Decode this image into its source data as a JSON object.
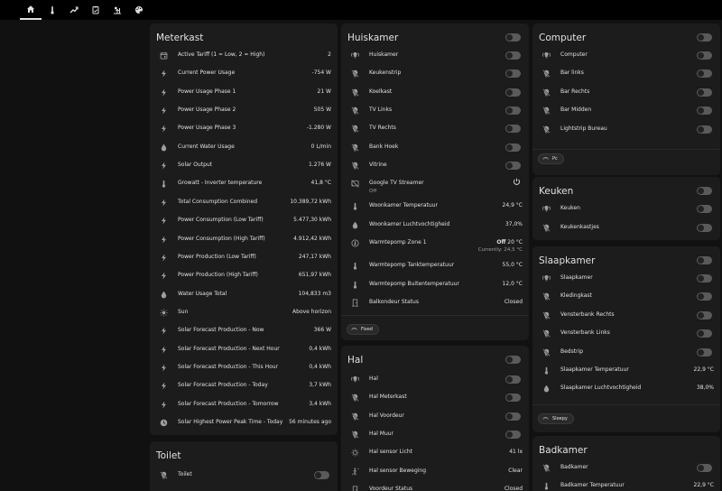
{
  "nav": {
    "tabs": [
      {
        "icon": "home-icon",
        "active": true
      },
      {
        "icon": "thermometer-icon",
        "active": false
      },
      {
        "icon": "chart-icon",
        "active": false
      },
      {
        "icon": "clipboard-icon",
        "active": false
      },
      {
        "icon": "weather-icon",
        "active": false
      },
      {
        "icon": "palette-icon",
        "active": false
      }
    ]
  },
  "meterkast": {
    "title": "Meterkast",
    "rows": [
      {
        "icon": "calendar-icon",
        "name": "Active Tariff (1 = Low, 2 = High)",
        "value": "2"
      },
      {
        "icon": "flash-icon",
        "name": "Current Power Usage",
        "value": "-754 W"
      },
      {
        "icon": "flash-icon",
        "name": "Power Usage Phase 1",
        "value": "21 W"
      },
      {
        "icon": "flash-icon",
        "name": "Power Usage Phase 2",
        "value": "505 W"
      },
      {
        "icon": "flash-icon",
        "name": "Power Usage Phase 3",
        "value": "-1.280 W"
      },
      {
        "icon": "water-icon",
        "name": "Current Water Usage",
        "value": "0 L/min"
      },
      {
        "icon": "flash-icon",
        "name": "Solar Output",
        "value": "1.276 W"
      },
      {
        "icon": "thermometer-icon",
        "name": "Growatt - Inverter temperature",
        "value": "41,8 °C"
      },
      {
        "icon": "flash-icon",
        "name": "Total Consumption Combined",
        "value": "10.389,72 kWh"
      },
      {
        "icon": "flash-icon",
        "name": "Power Consumption (Low Tariff)",
        "value": "5.477,30 kWh"
      },
      {
        "icon": "flash-icon",
        "name": "Power Consumption (High Tariff)",
        "value": "4.912,42 kWh"
      },
      {
        "icon": "flash-icon",
        "name": "Power Production (Low Tariff)",
        "value": "247,17 kWh"
      },
      {
        "icon": "flash-icon",
        "name": "Power Production (High Tariff)",
        "value": "651,97 kWh"
      },
      {
        "icon": "water-icon",
        "name": "Water Usage Total",
        "value": "104,833 m3"
      },
      {
        "icon": "sun-icon",
        "name": "Sun",
        "value": "Above horizon"
      },
      {
        "icon": "flash-icon",
        "name": "Solar Forecast Production - Now",
        "value": "366 W"
      },
      {
        "icon": "flash-icon",
        "name": "Solar Forecast Production - Next Hour",
        "value": "0,4 kWh"
      },
      {
        "icon": "flash-icon",
        "name": "Solar Forecast Production - This Hour",
        "value": "0,4 kWh"
      },
      {
        "icon": "flash-icon",
        "name": "Solar Forecast Production - Today",
        "value": "3,7 kWh"
      },
      {
        "icon": "flash-icon",
        "name": "Solar Forecast Production - Tomorrow",
        "value": "3,4 kWh"
      },
      {
        "icon": "clock-icon",
        "name": "Solar Highest Power Peak Time - Today",
        "value": "56 minutes ago"
      }
    ]
  },
  "toilet": {
    "title": "Toilet",
    "rows": [
      {
        "icon": "lightbulb-off-icon",
        "name": "Toilet"
      }
    ]
  },
  "huiskamer": {
    "title": "Huiskamer",
    "rows": [
      {
        "icon": "lightbulb-group-icon",
        "name": "Huiskamer",
        "type": "toggle"
      },
      {
        "icon": "lightbulb-off-icon",
        "name": "Keukenstrip",
        "type": "toggle"
      },
      {
        "icon": "lightbulb-off-icon",
        "name": "Koelkast",
        "type": "toggle"
      },
      {
        "icon": "lightbulb-off-icon",
        "name": "TV Links",
        "type": "toggle"
      },
      {
        "icon": "lightbulb-off-icon",
        "name": "TV Rechts",
        "type": "toggle"
      },
      {
        "icon": "lightbulb-off-icon",
        "name": "Bank Hoek",
        "type": "toggle"
      },
      {
        "icon": "lightbulb-off-icon",
        "name": "Vitrine",
        "type": "toggle"
      },
      {
        "icon": "cast-off-icon",
        "name": "Google TV Streamer",
        "sub": "Off",
        "type": "power"
      },
      {
        "icon": "thermometer-icon",
        "name": "Woonkamer Temperatuur",
        "value": "24,9 °C",
        "type": "value"
      },
      {
        "icon": "water-icon",
        "name": "Woonkamer Luchtvochtigheid",
        "value": "37,0%",
        "type": "value"
      },
      {
        "icon": "thermostat-icon",
        "name": "Warmtepomp Zone 1",
        "value_bold": "Off",
        "value": "20 °C",
        "value2": "Currently: 24,5 °C",
        "type": "climate"
      },
      {
        "icon": "thermometer-icon",
        "name": "Warmtepomp Tanktemperatuur",
        "value": "55,0 °C",
        "type": "value"
      },
      {
        "icon": "thermometer-icon",
        "name": "Warmtepomp Buitentemperatuur",
        "value": "12,0 °C",
        "type": "value"
      },
      {
        "icon": "door-icon",
        "name": "Balkondeur Status",
        "value": "Closed",
        "type": "value"
      }
    ],
    "chip": "Fixed"
  },
  "hal": {
    "title": "Hal",
    "rows": [
      {
        "icon": "lightbulb-group-icon",
        "name": "Hal",
        "type": "toggle"
      },
      {
        "icon": "lightbulb-off-icon",
        "name": "Hal Meterkast",
        "type": "toggle"
      },
      {
        "icon": "lightbulb-off-icon",
        "name": "Hal Voordeur",
        "type": "toggle"
      },
      {
        "icon": "lightbulb-off-icon",
        "name": "Hal Muur",
        "type": "toggle"
      },
      {
        "icon": "brightness-icon",
        "name": "Hal sensor Licht",
        "value": "41 lx",
        "type": "value"
      },
      {
        "icon": "motion-sensor-icon",
        "name": "Hal sensor Beweging",
        "value": "Clear",
        "type": "value"
      },
      {
        "icon": "door-icon",
        "name": "Voordeur Status",
        "value": "Closed",
        "type": "value"
      }
    ]
  },
  "computer": {
    "title": "Computer",
    "rows": [
      {
        "icon": "lightbulb-group-icon",
        "name": "Computer"
      },
      {
        "icon": "lightbulb-off-icon",
        "name": "Bar links"
      },
      {
        "icon": "lightbulb-off-icon",
        "name": "Bar Rechts"
      },
      {
        "icon": "lightbulb-off-icon",
        "name": "Bar Midden"
      },
      {
        "icon": "lightbulb-off-icon",
        "name": "Lightstrip Bureau"
      }
    ],
    "chip": "Pc"
  },
  "keuken": {
    "title": "Keuken",
    "rows": [
      {
        "icon": "lightbulb-group-icon",
        "name": "Keuken"
      },
      {
        "icon": "lightbulb-off-icon",
        "name": "Keukenkastjes"
      }
    ]
  },
  "slaapkamer": {
    "title": "Slaapkamer",
    "rows": [
      {
        "icon": "lightbulb-group-icon",
        "name": "Slaapkamer",
        "type": "toggle"
      },
      {
        "icon": "lightbulb-off-icon",
        "name": "Kledingkast",
        "type": "toggle"
      },
      {
        "icon": "lightbulb-off-icon",
        "name": "Vensterbank Rechts",
        "type": "toggle"
      },
      {
        "icon": "lightbulb-off-icon",
        "name": "Vensterbank Links",
        "type": "toggle"
      },
      {
        "icon": "lightbulb-off-icon",
        "name": "Bedstrip",
        "type": "toggle"
      },
      {
        "icon": "thermometer-icon",
        "name": "Slaapkamer Temperatuur",
        "value": "22,9 °C",
        "type": "value"
      },
      {
        "icon": "water-icon",
        "name": "Slaapkamer Luchtvochtigheid",
        "value": "38,0%",
        "type": "value"
      }
    ],
    "chip": "Sleepy"
  },
  "badkamer": {
    "title": "Badkamer",
    "rows": [
      {
        "icon": "lightbulb-off-icon",
        "name": "Badkamer",
        "type": "toggle"
      },
      {
        "icon": "thermometer-icon",
        "name": "Badkamer Temperatuur",
        "value": "22,9 °C",
        "type": "value"
      }
    ]
  }
}
